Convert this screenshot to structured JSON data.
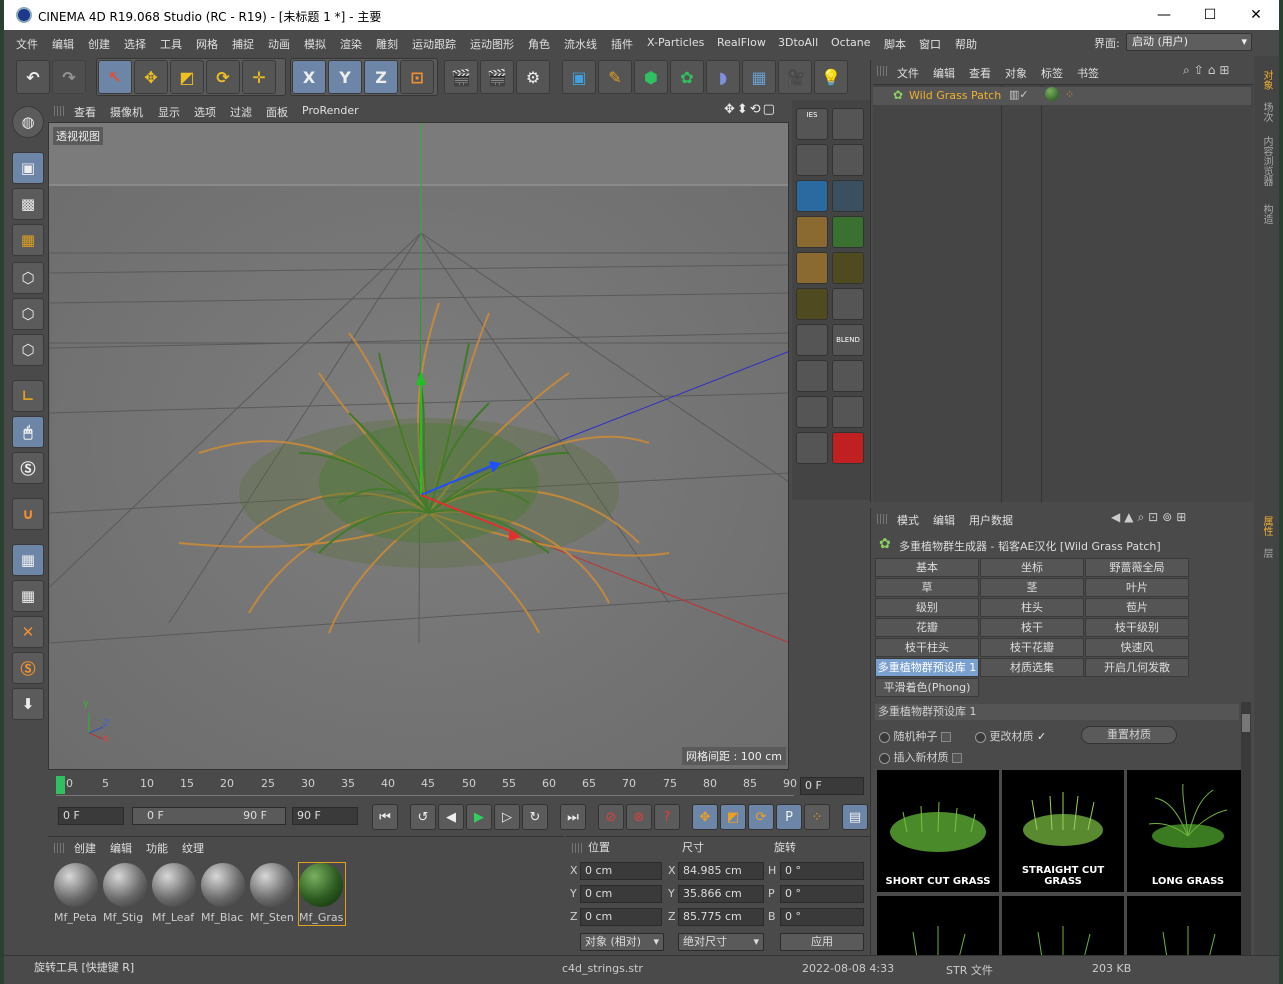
{
  "window": {
    "title": "CINEMA 4D R19.068 Studio (RC - R19) - [未标题 1 *] - 主要",
    "minimize": "—",
    "maximize": "☐",
    "close": "✕"
  },
  "menu": [
    "文件",
    "编辑",
    "创建",
    "选择",
    "工具",
    "网格",
    "捕捉",
    "动画",
    "模拟",
    "渲染",
    "雕刻",
    "运动跟踪",
    "运动图形",
    "角色",
    "流水线",
    "插件",
    "X-Particles",
    "RealFlow",
    "3DtoAll",
    "Octane",
    "脚本",
    "窗口",
    "帮助"
  ],
  "layout": {
    "label": "界面:",
    "value": "启动 (用户)"
  },
  "toolbar": {
    "x": "X",
    "y": "Y",
    "z": "Z"
  },
  "viewport": {
    "menu": [
      "查看",
      "摄像机",
      "显示",
      "选项",
      "过滤",
      "面板",
      "ProRender"
    ],
    "label": "透视视图",
    "grid_spacing": "网格间距 : 100 cm",
    "axis_x": "X",
    "axis_y": "Y",
    "axis_z": "Z"
  },
  "matmgr": {
    "ies": "IES",
    "blend": "BLEND"
  },
  "timeline": {
    "ticks": [
      "0",
      "5",
      "10",
      "15",
      "20",
      "25",
      "30",
      "35",
      "40",
      "45",
      "50",
      "55",
      "60",
      "65",
      "70",
      "75",
      "80",
      "85",
      "90"
    ],
    "current_frame": "0 F"
  },
  "transport": {
    "start": "0 F",
    "range_start": "0 F",
    "range_end": "90 F",
    "end": "90 F",
    "key_p": "P"
  },
  "materials": {
    "menu": [
      "创建",
      "编辑",
      "功能",
      "纹理"
    ],
    "items": [
      "Mf_Peta",
      "Mf_Stig",
      "Mf_Leaf",
      "Mf_Blac",
      "Mf_Sten",
      "Mf_Gras"
    ]
  },
  "coords": {
    "headers": [
      "位置",
      "尺寸",
      "旋转"
    ],
    "rows": [
      {
        "a": "X",
        "pos": "0 cm",
        "b": "X",
        "size": "84.985 cm",
        "c": "H",
        "rot": "0 °"
      },
      {
        "a": "Y",
        "pos": "0 cm",
        "b": "Y",
        "size": "35.866 cm",
        "c": "P",
        "rot": "0 °"
      },
      {
        "a": "Z",
        "pos": "0 cm",
        "b": "Z",
        "size": "85.775 cm",
        "c": "B",
        "rot": "0 °"
      }
    ],
    "mode": "对象 (相对)",
    "size_mode": "绝对尺寸",
    "apply": "应用"
  },
  "status": "旋转工具 [快捷键 R]",
  "taskbar": {
    "file": "c4d_strings.str",
    "date": "2022-08-08 4:33",
    "type": "STR 文件",
    "size": "203 KB"
  },
  "objmgr": {
    "menu": [
      "文件",
      "编辑",
      "查看",
      "对象",
      "标签",
      "书签"
    ],
    "object": "Wild Grass Patch"
  },
  "attrmgr": {
    "menu": [
      "模式",
      "编辑",
      "用户数据"
    ],
    "title": "多重植物群生成器 - 韬客AE汉化 [Wild Grass Patch]",
    "tabs": [
      [
        "基本",
        "坐标",
        "野蔷薇全局"
      ],
      [
        "草",
        "茎",
        "叶片"
      ],
      [
        "级别",
        "柱头",
        "苞片"
      ],
      [
        "花瓣",
        "枝干",
        "枝干级别"
      ],
      [
        "枝干柱头",
        "枝干花瓣",
        "快速风"
      ],
      [
        "多重植物群预设库 1",
        "材质选集",
        "开启几何发散"
      ],
      [
        "平滑着色(Phong)"
      ]
    ],
    "section": "多重植物群预设库 1",
    "opt_random_seed": "随机种子",
    "opt_change_material": "更改材质",
    "reset_material": "重置材质",
    "opt_insert_material": "插入新材质",
    "presets": [
      "SHORT CUT GRASS",
      "STRAIGHT CUT GRASS",
      "LONG GRASS"
    ]
  },
  "rightstrip": {
    "tabs": [
      "对象",
      "场次",
      "内容浏览器",
      "构造"
    ],
    "tabs2": [
      "属性",
      "层"
    ]
  },
  "colors": {
    "accent": "#7aa0d0",
    "orange": "#e0a020",
    "viewport_bg": "#7a7a7a"
  }
}
